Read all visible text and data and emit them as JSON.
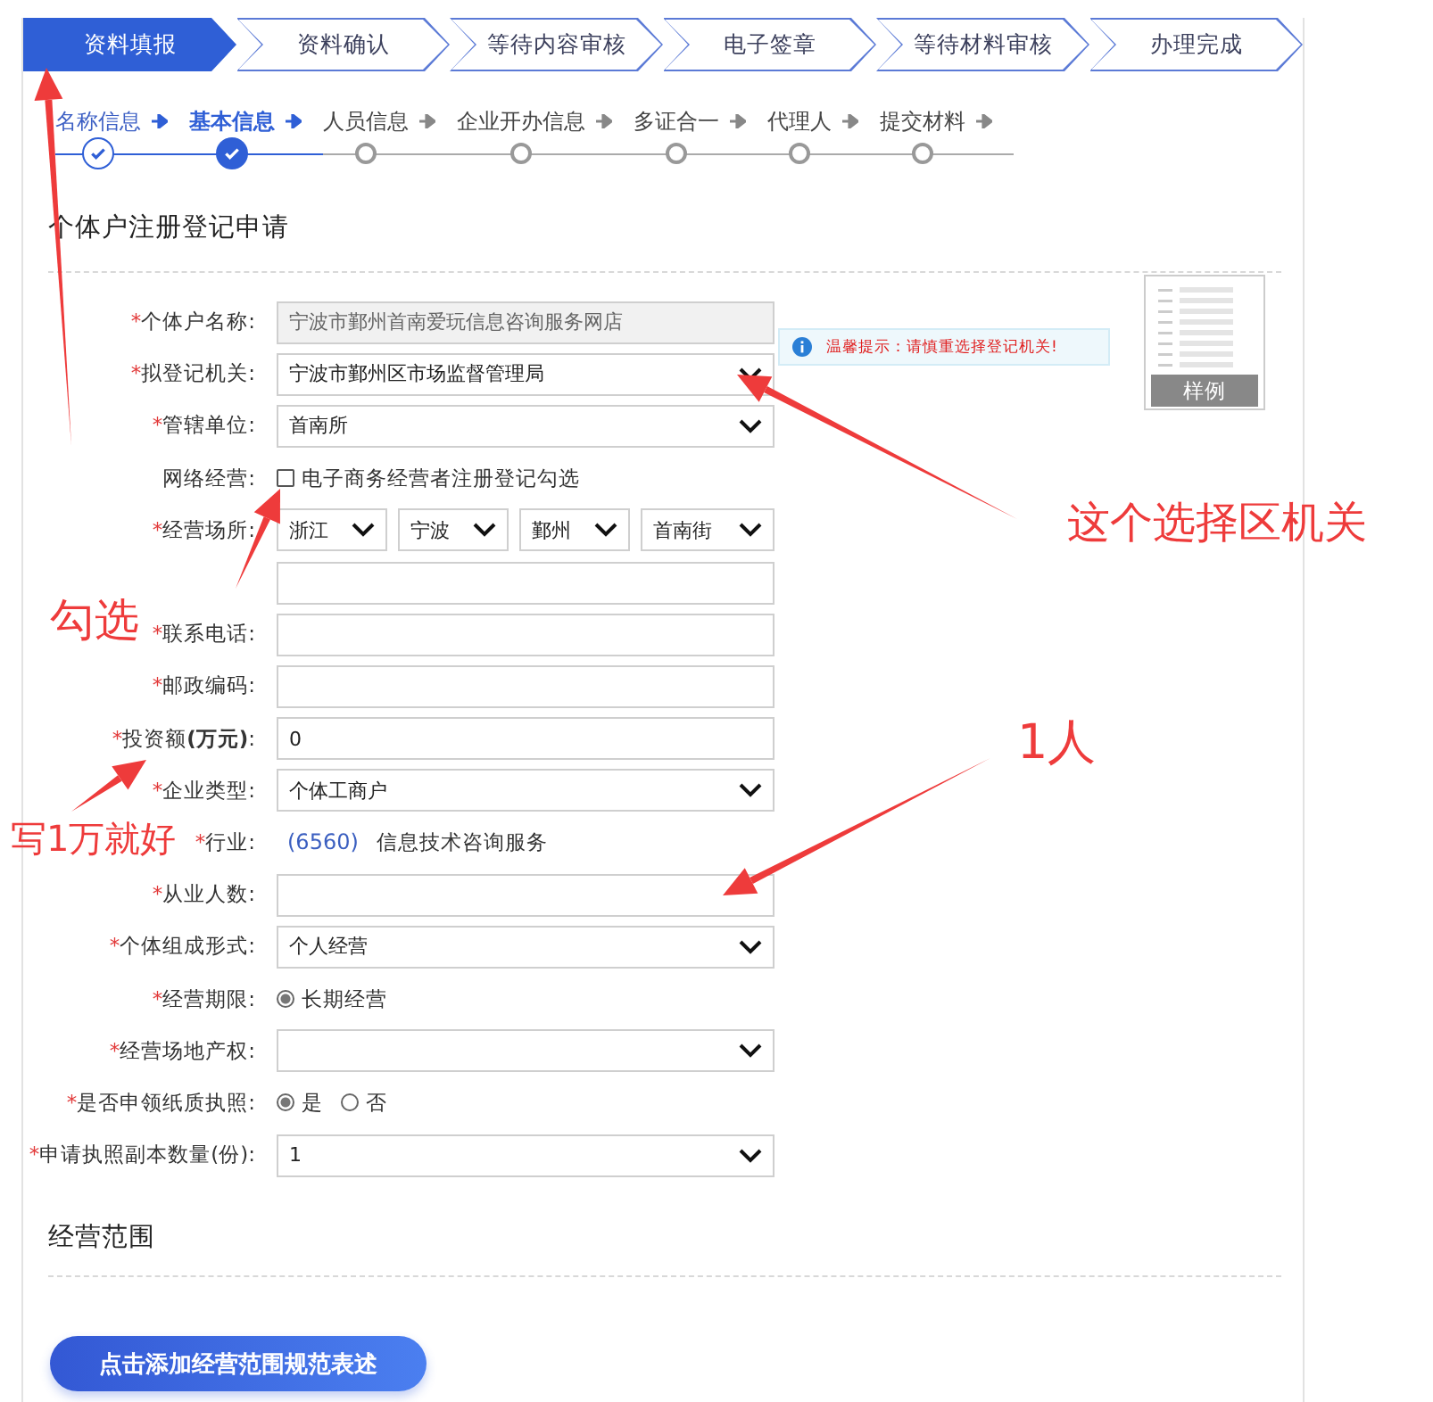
{
  "steps": [
    {
      "label": "资料填报",
      "selected": true
    },
    {
      "label": "资料确认",
      "selected": false
    },
    {
      "label": "等待内容审核",
      "selected": false
    },
    {
      "label": "电子签章",
      "selected": false
    },
    {
      "label": "等待材料审核",
      "selected": false
    },
    {
      "label": "办理完成",
      "selected": false
    }
  ],
  "sub_steps": [
    {
      "label": "名称信息",
      "done": true,
      "selected": false
    },
    {
      "label": "基本信息",
      "done": true,
      "selected": true
    },
    {
      "label": "人员信息",
      "done": false,
      "selected": false
    },
    {
      "label": "企业开办信息",
      "done": false,
      "selected": false
    },
    {
      "label": "多证合一",
      "done": false,
      "selected": false
    },
    {
      "label": "代理人",
      "done": false,
      "selected": false
    },
    {
      "label": "提交材料",
      "done": false,
      "selected": false
    }
  ],
  "form": {
    "title": "个体户注册登记申请",
    "fields": [
      {
        "kind": "input",
        "mark": "*",
        "label": "个体户名称:",
        "value": "宁波市鄞州首南爱玩信息咨询服务网店",
        "disabled": true
      },
      {
        "kind": "select",
        "mark": "*",
        "label": "拟登记机关:",
        "value": "宁波市鄞州区市场监督管理局"
      },
      {
        "kind": "select",
        "mark": "*",
        "label": "管辖单位:",
        "value": "首南所"
      },
      {
        "kind": "checkbox",
        "label": "网络经营:",
        "option": "电子商务经营者注册登记勾选",
        "checked": false
      },
      {
        "kind": "address",
        "mark": "*",
        "label": "经营场所:",
        "parts": [
          "浙江",
          "宁波",
          "鄞州",
          "首南街"
        ]
      },
      {
        "kind": "input",
        "disabled": false
      },
      {
        "kind": "input",
        "mark": "*",
        "label": "联系电话:",
        "disabled": false
      },
      {
        "kind": "input",
        "mark": "*",
        "label": "邮政编码:",
        "disabled": false
      },
      {
        "kind": "input",
        "mark": "*",
        "label": "投资额**(万元)**:",
        "value": "0",
        "disabled": false
      },
      {
        "kind": "select",
        "mark": "*",
        "label": "企业类型:",
        "value": "个体工商户"
      },
      {
        "kind": "industry",
        "mark": "*",
        "label": "行业:",
        "code": "(6560)",
        "name": "信息技术咨询服务"
      },
      {
        "kind": "input",
        "mark": "*",
        "label": "从业人数:",
        "disabled": false
      },
      {
        "kind": "select",
        "mark": "*",
        "label": "个体组成形式:",
        "value": "个人经营"
      },
      {
        "kind": "radio",
        "mark": "*",
        "label": "经营期限:",
        "options": [
          {
            "label": "长期经营",
            "selected": true
          }
        ]
      },
      {
        "kind": "select",
        "mark": "*",
        "label": "经营场地产权:"
      },
      {
        "kind": "radio",
        "mark": "*",
        "label": "是否申领纸质执照:",
        "options": [
          {
            "label": "是",
            "selected": true
          },
          {
            "label": "否",
            "selected": false
          }
        ]
      },
      {
        "kind": "select",
        "mark": "*",
        "label": "申请执照副本数量(份):",
        "value": "1"
      }
    ],
    "tooltip": "温馨提示：请慎重选择登记机关!",
    "sample_label": "样例"
  },
  "scope": {
    "title": "经营范围",
    "button": "点击添加经营范围规范表述"
  },
  "annotations": [
    {
      "text": "这个选择区机关"
    },
    {
      "text": "勾选"
    },
    {
      "text": "写1万就好"
    },
    {
      "text": "1人"
    }
  ]
}
